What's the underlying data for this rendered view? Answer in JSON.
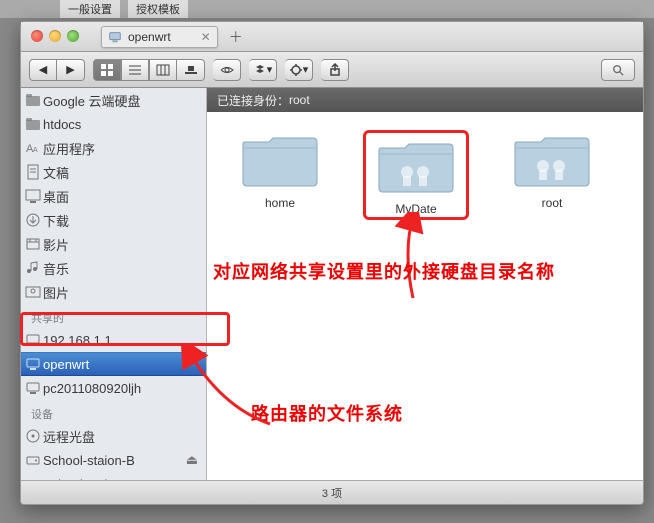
{
  "bg_tabs": [
    "一般设置",
    "授权模板"
  ],
  "window": {
    "tab_title": "openwrt"
  },
  "toolbar": {
    "views": [
      "icon",
      "list",
      "column",
      "coverflow"
    ]
  },
  "pathbar": {
    "prefix": "已连接身份：",
    "user": "root"
  },
  "sidebar": {
    "favorites": [
      {
        "label": "Google 云端硬盘",
        "icon": "folder"
      },
      {
        "label": "htdocs",
        "icon": "folder"
      },
      {
        "label": "应用程序",
        "icon": "apps"
      },
      {
        "label": "文稿",
        "icon": "doc"
      },
      {
        "label": "桌面",
        "icon": "desktop"
      },
      {
        "label": "下载",
        "icon": "download"
      },
      {
        "label": "影片",
        "icon": "movie"
      },
      {
        "label": "音乐",
        "icon": "music"
      },
      {
        "label": "图片",
        "icon": "picture"
      }
    ],
    "shared_label": "共享的",
    "shared": [
      {
        "label": "192.168.1.1",
        "icon": "server"
      },
      {
        "label": "openwrt",
        "icon": "server",
        "selected": true
      },
      {
        "label": "pc2011080920ljh",
        "icon": "server"
      }
    ],
    "devices_label": "设备",
    "devices": [
      {
        "label": "远程光盘",
        "icon": "disc"
      },
      {
        "label": "School-staion-B",
        "icon": "drive",
        "eject": true
      },
      {
        "label": "School-staion-A",
        "icon": "drive",
        "eject": true
      }
    ]
  },
  "folders": [
    {
      "name": "home",
      "shared": false,
      "highlight": false
    },
    {
      "name": "MyDate",
      "shared": true,
      "highlight": true
    },
    {
      "name": "root",
      "shared": true,
      "highlight": false
    }
  ],
  "status": {
    "count": "3 项"
  },
  "annotations": {
    "top": "对应网络共享设置里的外接硬盘目录名称",
    "bottom": "路由器的文件系统"
  }
}
